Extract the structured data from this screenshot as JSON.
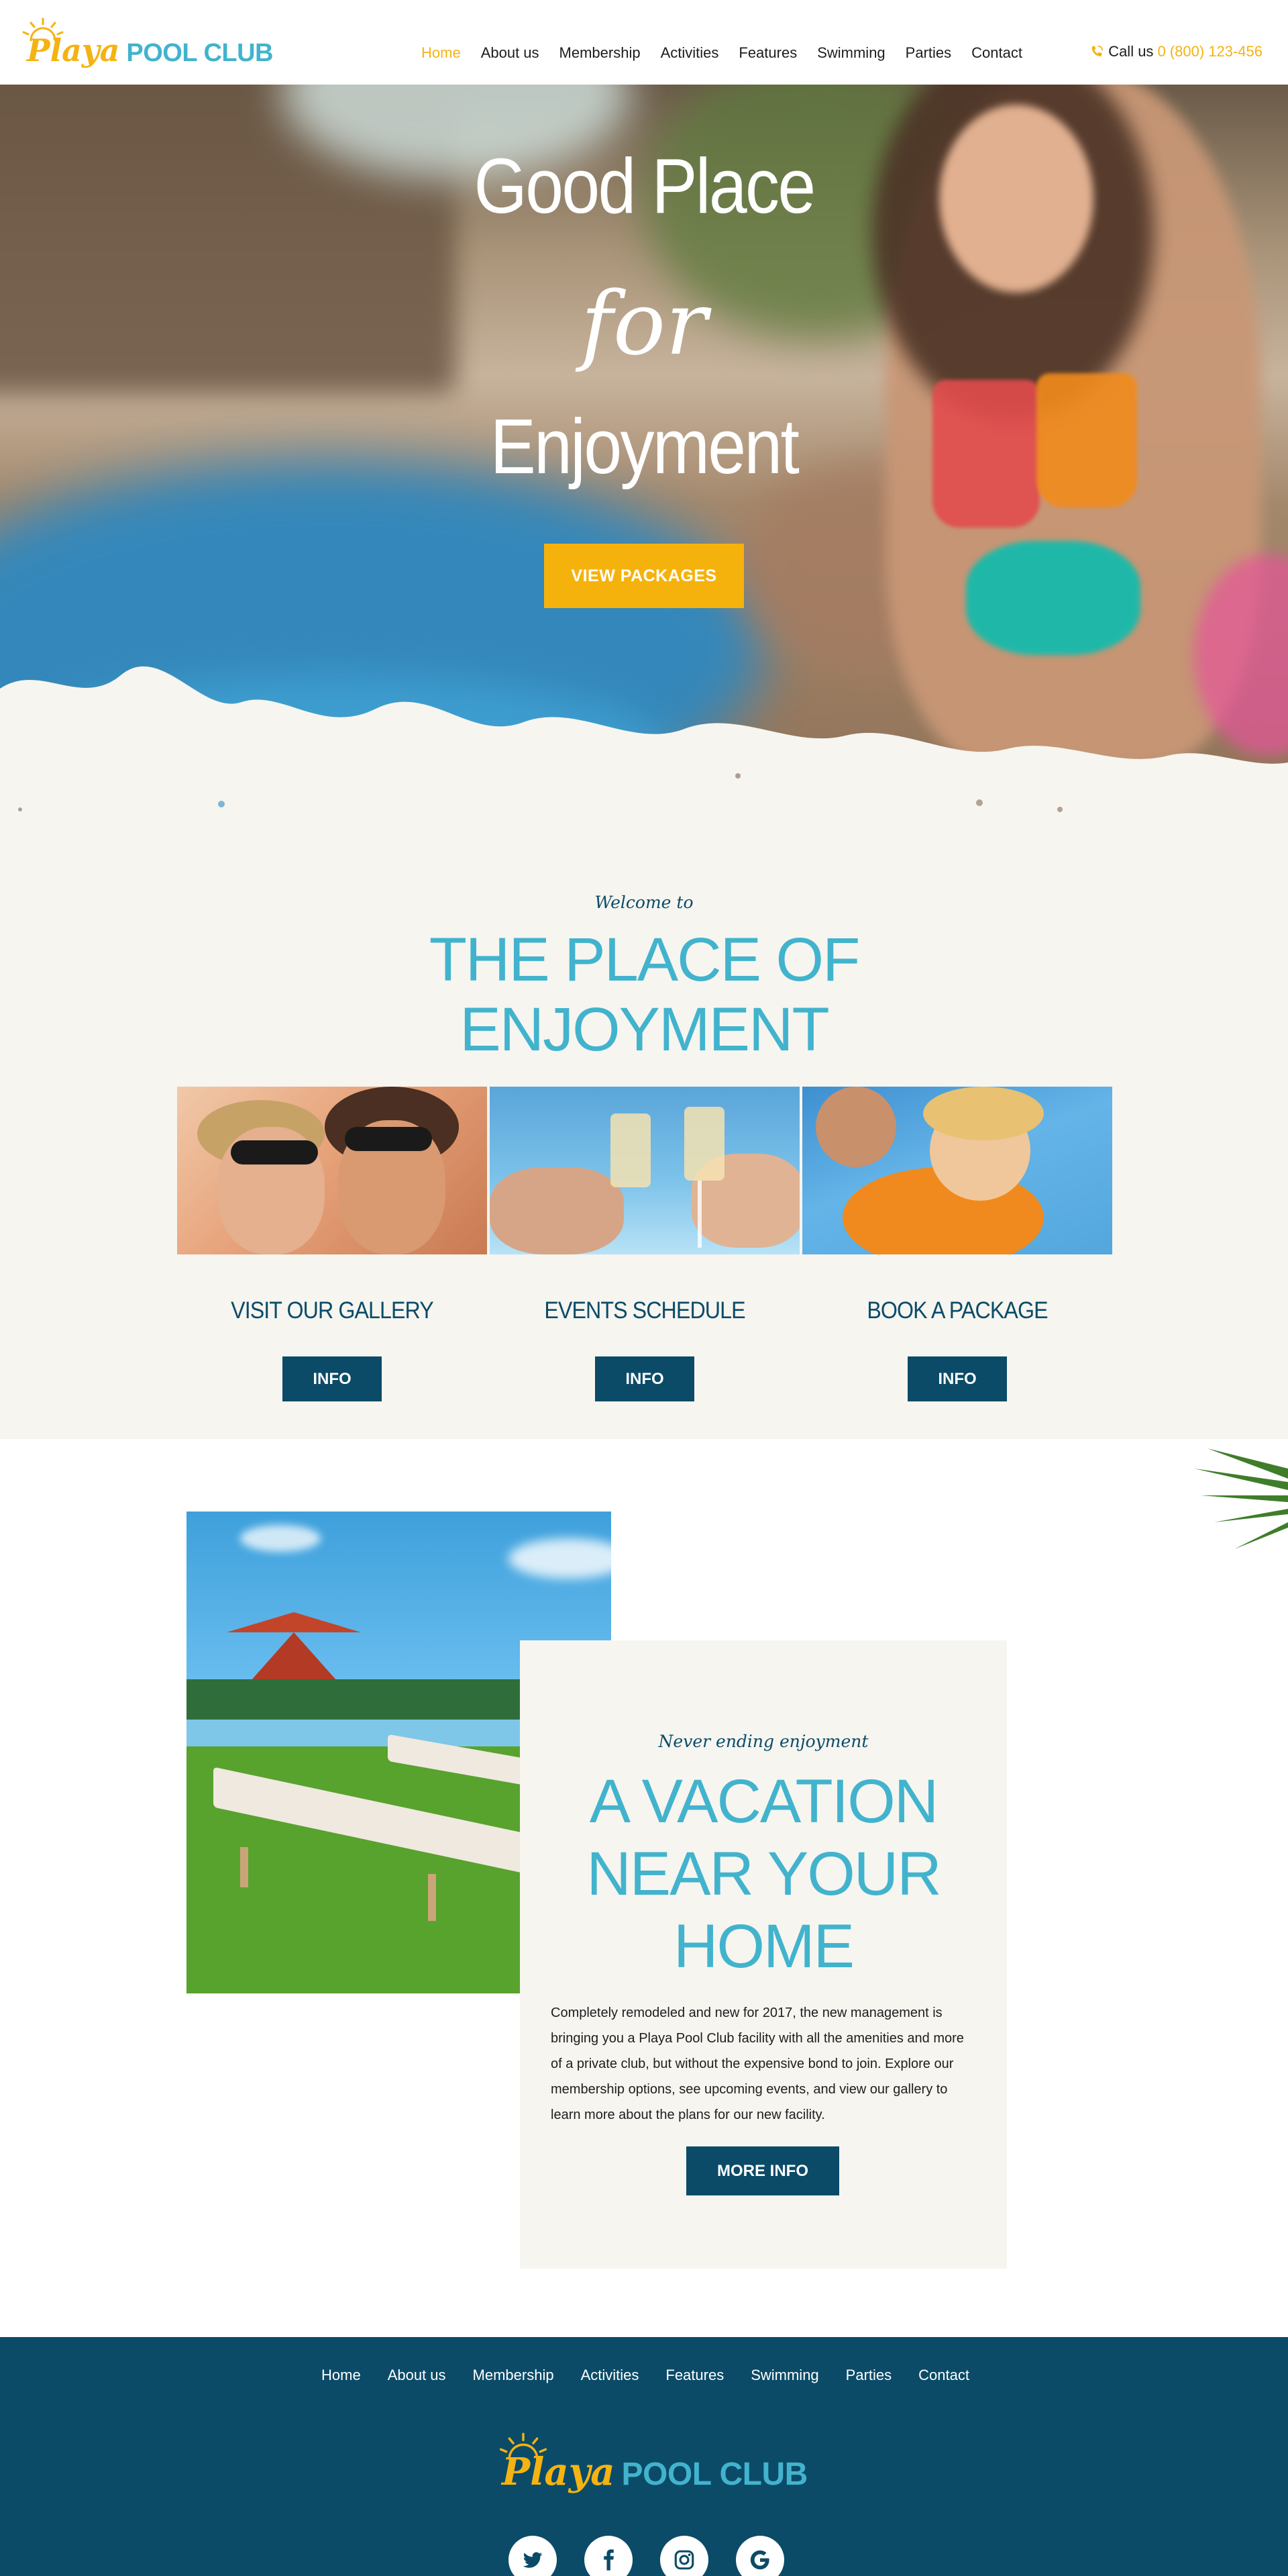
{
  "header": {
    "logo": {
      "word1": "Playa",
      "word2": "POOL CLUB"
    },
    "nav": [
      {
        "label": "Home",
        "active": true
      },
      {
        "label": "About us"
      },
      {
        "label": "Membership"
      },
      {
        "label": "Activities"
      },
      {
        "label": "Features"
      },
      {
        "label": "Swimming"
      },
      {
        "label": "Parties"
      },
      {
        "label": "Contact"
      }
    ],
    "call": {
      "label": "Call us",
      "phone": "0 (800) 123-456",
      "icon": "phone-icon"
    }
  },
  "hero": {
    "line1": "Good Place",
    "line2": "for",
    "line3": "Enjoyment",
    "button": "VIEW PACKAGES"
  },
  "welcome": {
    "kicker": "Welcome to",
    "title_line1": "THE PLACE OF",
    "title_line2": "ENJOYMENT",
    "cards": [
      {
        "title": "VISIT OUR GALLERY",
        "button": "INFO"
      },
      {
        "title": "EVENTS SCHEDULE",
        "button": "INFO"
      },
      {
        "title": "BOOK A PACKAGE",
        "button": "INFO"
      }
    ]
  },
  "vacation": {
    "kicker": "Never ending enjoyment",
    "title_line1": "A VACATION",
    "title_line2": "NEAR YOUR",
    "title_line3": "HOME",
    "paragraph": "Completely remodeled and new for 2017, the new management is bringing you a Playa Pool Club facility with all the amenities and more of a private club, but without the expensive bond to join. Explore our membership options, see upcoming events, and view our gallery to learn more about the plans for our new facility.",
    "button": "MORE INFO"
  },
  "footer": {
    "nav": [
      "Home",
      "About us",
      "Membership",
      "Activities",
      "Features",
      "Swimming",
      "Parties",
      "Contact"
    ],
    "logo": {
      "word1": "Playa",
      "word2": "POOL CLUB"
    },
    "socials": [
      "twitter-icon",
      "facebook-icon",
      "instagram-icon",
      "google-icon"
    ]
  },
  "colors": {
    "brand_yellow": "#f4b312",
    "brand_teal": "#42b3cd",
    "navy": "#0b4b68",
    "cream": "#f6f5f0"
  }
}
